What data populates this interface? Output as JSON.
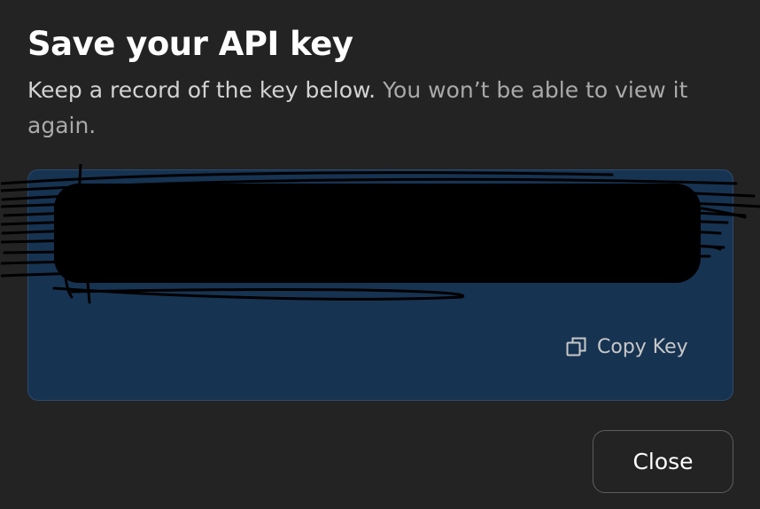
{
  "dialog": {
    "title": "Save your API key",
    "subtitle_main": "Keep a record of the key below.",
    "subtitle_muted": "You won’t be able to view it again."
  },
  "key_box": {
    "key_value": "",
    "copy_label": "Copy Key",
    "copy_icon": "copy-icon",
    "background_color": "#173352"
  },
  "actions": {
    "close_label": "Close"
  }
}
